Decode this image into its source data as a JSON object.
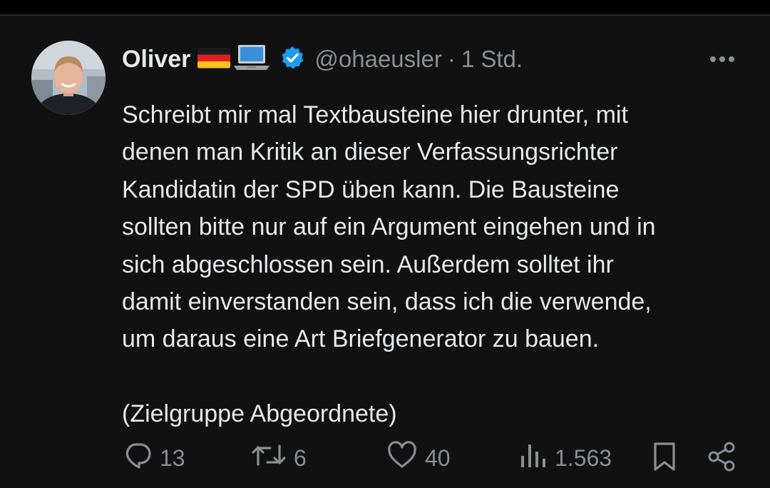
{
  "tweet": {
    "author": {
      "name": "Oliver",
      "emojis": [
        "german-flag",
        "laptop"
      ],
      "verified": true,
      "handle": "@ohaeusler"
    },
    "separator": "·",
    "time": "1 Std.",
    "body_lines": [
      "Schreibt mir mal Textbausteine hier drunter, mit",
      "denen man Kritik an dieser Verfassungsrichter",
      "Kandidatin der SPD üben kann. Die Bausteine",
      "sollten bitte nur auf ein Argument eingehen und in",
      "sich abgeschlossen sein. Außerdem solltet ihr",
      "damit einverstanden sein, dass ich die verwende,",
      "um daraus eine Art Briefgenerator zu bauen."
    ],
    "body_footer": "(Zielgruppe Abgeordnete)",
    "actions": {
      "replies": "13",
      "reposts": "6",
      "likes": "40",
      "views": "1.563"
    }
  },
  "colors": {
    "background": "#111112",
    "text": "#e7e9ea",
    "muted": "#8b8f94",
    "verified": "#1d9bf0"
  }
}
